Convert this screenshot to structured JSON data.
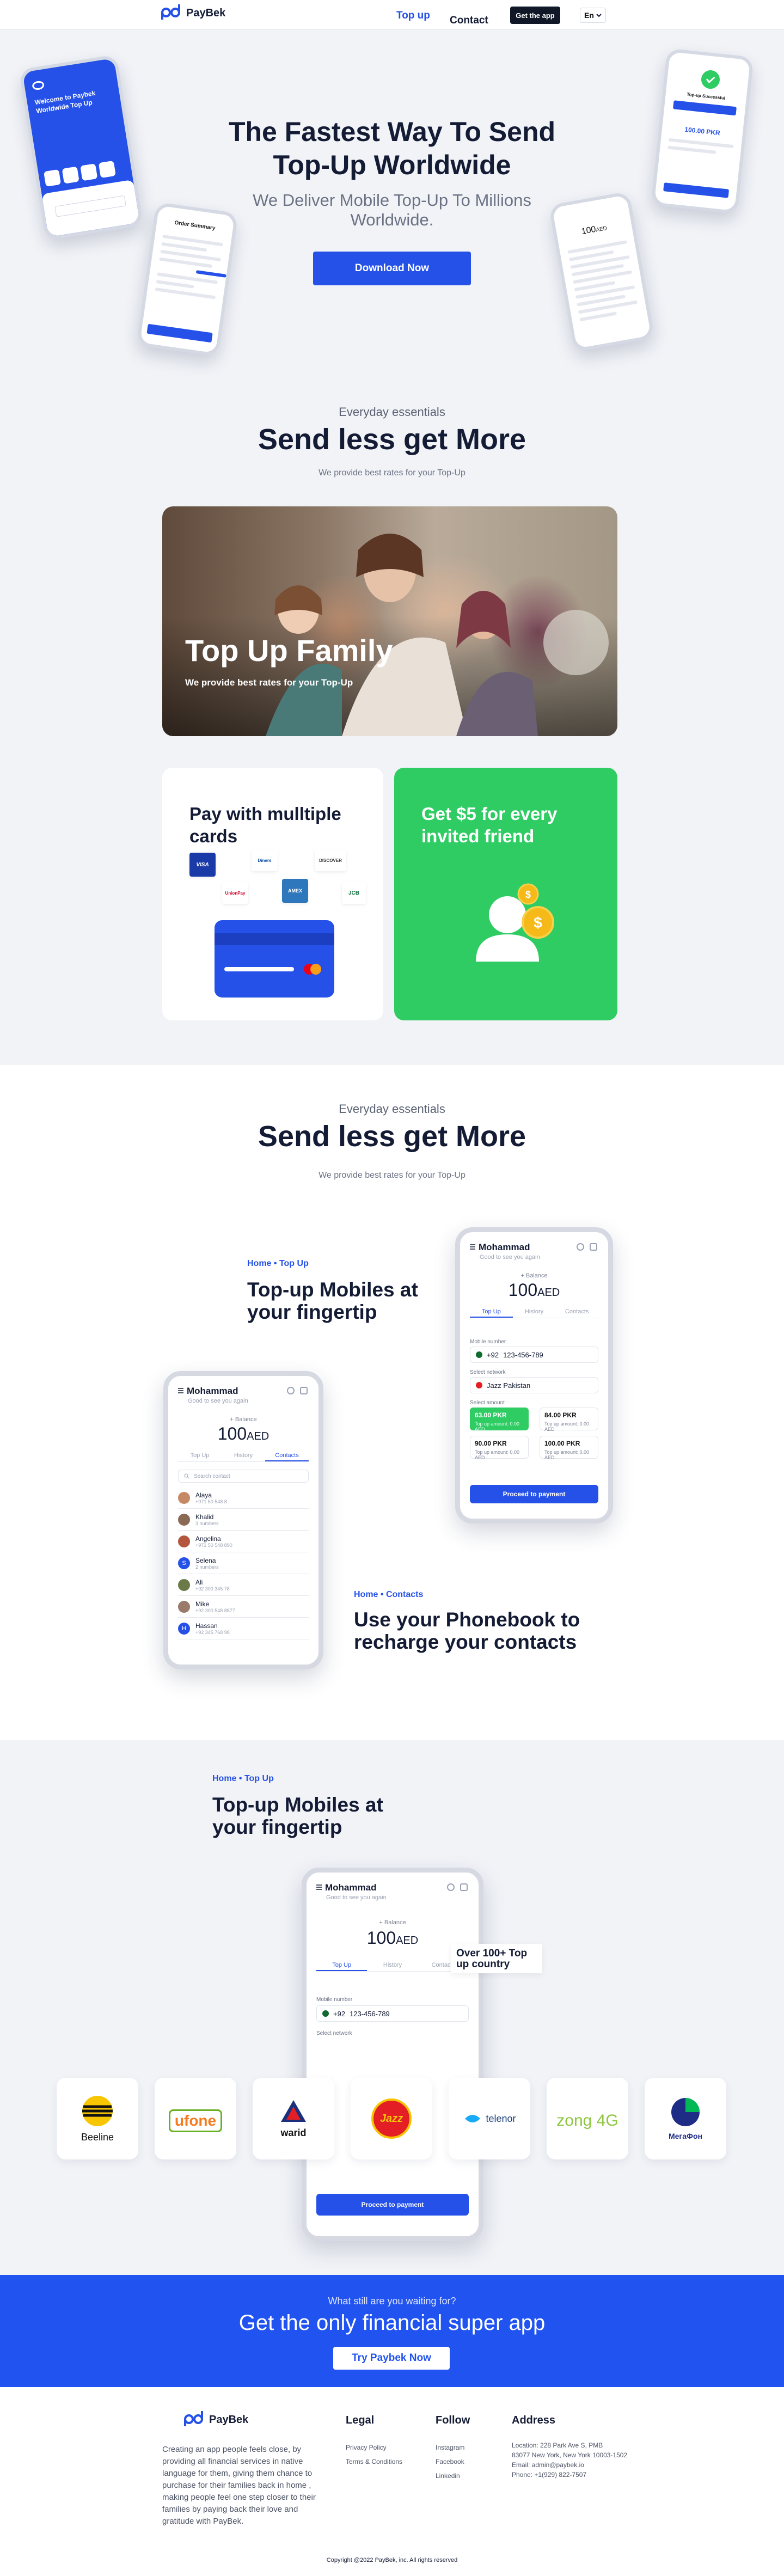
{
  "nav": {
    "brand": "PayBek",
    "topup": "Top up",
    "contact": "Contact",
    "get_app": "Get the app",
    "lang": "En"
  },
  "hero": {
    "title": "The Fastest Way To Send Top-Up Worldwide",
    "subtitle": "We Deliver Mobile Top-Up To Millions Worldwide.",
    "cta": "Download Now",
    "phone1_title": "Welcome to Paybek Worldwide Top Up",
    "phone2_title": "Order Summary",
    "phone3_amount": "100.00 PKR",
    "phone3_title": "Top-up Successful"
  },
  "essentials": {
    "kicker": "Everyday essentials",
    "title": "Send less get More",
    "sub": "We provide best rates for your Top-Up",
    "family_title": "Top Up Family",
    "family_sub": "We provide best rates for your Top-Up",
    "pay_title": "Pay with mulltiple cards",
    "invite_title": "Get $5 for every invited friend",
    "pay_methods": [
      "VISA",
      "Diners",
      "DISCOVER",
      "UnionPay",
      "AMEX",
      "JCB"
    ]
  },
  "features": {
    "kicker": "Everyday essentials",
    "title": "Send less get More",
    "sub": "We provide best rates for your Top-Up",
    "f1_crumb": "Home • Top Up",
    "f1_title": "Top-up Mobiles at your fingertip",
    "f2_crumb": "Home • Contacts",
    "f2_title": "Use your Phonebook to recharge your contacts"
  },
  "app": {
    "user": "Mohammad",
    "greeting": "Good to see you again",
    "balance_label": "+ Balance",
    "balance": "100",
    "currency": "AED",
    "tabs": [
      "Top Up",
      "History",
      "Contacts"
    ],
    "mobile_label": "Mobile number",
    "code": "+92",
    "number": "123-456-789",
    "network_label": "Select network",
    "network": "Jazz Pakistan",
    "amount_label": "Select amount",
    "amounts": [
      {
        "value": "63.00 PKR",
        "sub": "Top up amount: 0.00 AED"
      },
      {
        "value": "84.00 PKR",
        "sub": "Top up amount: 0.00 AED"
      },
      {
        "value": "90.00 PKR",
        "sub": "Top up amount: 0.00 AED"
      },
      {
        "value": "100.00 PKR",
        "sub": "Top up amount: 0.00 AED"
      }
    ],
    "proceed": "Proceed to payment",
    "search": "Search contact",
    "contacts": [
      {
        "name": "Alaya",
        "phone": "+971 50 548 8"
      },
      {
        "name": "Khalid",
        "phone": "3 numbers"
      },
      {
        "name": "Angelina",
        "phone": "+971 50 548 890"
      },
      {
        "name": "Selena",
        "phone": "2 numbers"
      },
      {
        "name": "Ali",
        "phone": "+92 300 345 78"
      },
      {
        "name": "Mike",
        "phone": "+92 300 548 8877"
      },
      {
        "name": "Hassan",
        "phone": "+92 345 768 98"
      }
    ]
  },
  "countries": {
    "crumb": "Home • Top Up",
    "title": "Top-up Mobiles at your fingertip",
    "badge": "Over 100+ Top up country",
    "operators": [
      "Beeline",
      "ufone",
      "warid",
      "Jazz",
      "telenor",
      "zong 4G",
      "МегаФон"
    ]
  },
  "cta": {
    "question": "What still are you waiting for?",
    "title": "Get the only financial super app",
    "button": "Try Paybek Now"
  },
  "footer": {
    "about": "Creating an app people feels close, by providing all financial services in native language for them, giving them chance to purchase for their families back in home , making people feel one step closer to their families by paying back their love and gratitude with PayBek.",
    "legal_h": "Legal",
    "legal": [
      "Privacy Policy",
      "Terms & Conditions"
    ],
    "follow_h": "Follow",
    "follow": [
      "Instagram",
      "Facebook",
      "Linkedin"
    ],
    "address_h": "Address",
    "address": [
      "Location: 228 Park Ave S, PMB",
      "83077 New York, New York 10003-1502",
      "Email: admin@paybek.io",
      "Phone: +1(929) 822-7507"
    ],
    "copyright": "Copyright @2022 PayBek, inc. All rights reserved"
  },
  "colors": {
    "brand_blue": "#2551e8",
    "green": "#2ecc63",
    "navy": "#141b34",
    "bg": "#f1f3f7"
  }
}
